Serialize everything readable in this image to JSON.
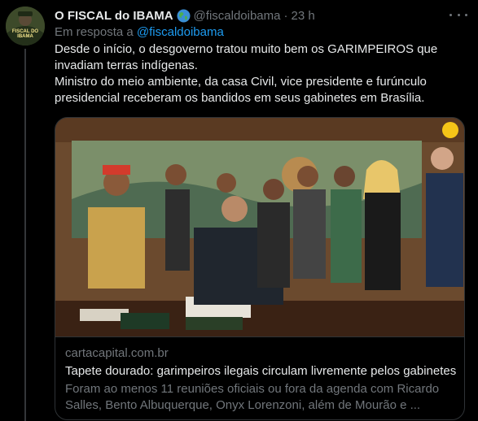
{
  "tweet": {
    "display_name": "O FISCAL do IBAMA",
    "handle": "@fiscaldoibama",
    "separator": "·",
    "time": "23 h",
    "reply_prefix": "Em resposta a",
    "reply_to": "@fiscaldoibama",
    "text_line1": "Desde o início, o desgoverno tratou muito bem os GARIMPEIROS que invadiam terras indígenas.",
    "text_line2": "Ministro do meio ambiente, da casa Civil, vice presidente e furúnculo presidencial receberam os bandidos em seus gabinetes em Brasília."
  },
  "avatar": {
    "label": "FISCAL DO IBAMA"
  },
  "card": {
    "domain": "cartacapital.com.br",
    "title": "Tapete dourado: garimpeiros ilegais circulam livremente pelos gabinetes",
    "description": "Foram ao menos 11 reuniões oficiais ou fora da agenda com Ricardo Salles, Bento Albuquerque, Onyx Lorenzoni, além de Mourão e ..."
  },
  "icons": {
    "globe": "globe-icon",
    "more": "more-options-icon"
  },
  "colors": {
    "background": "#000000",
    "text": "#e7e9ea",
    "muted": "#71767b",
    "link": "#1d9bf0",
    "border": "#2f3336"
  }
}
